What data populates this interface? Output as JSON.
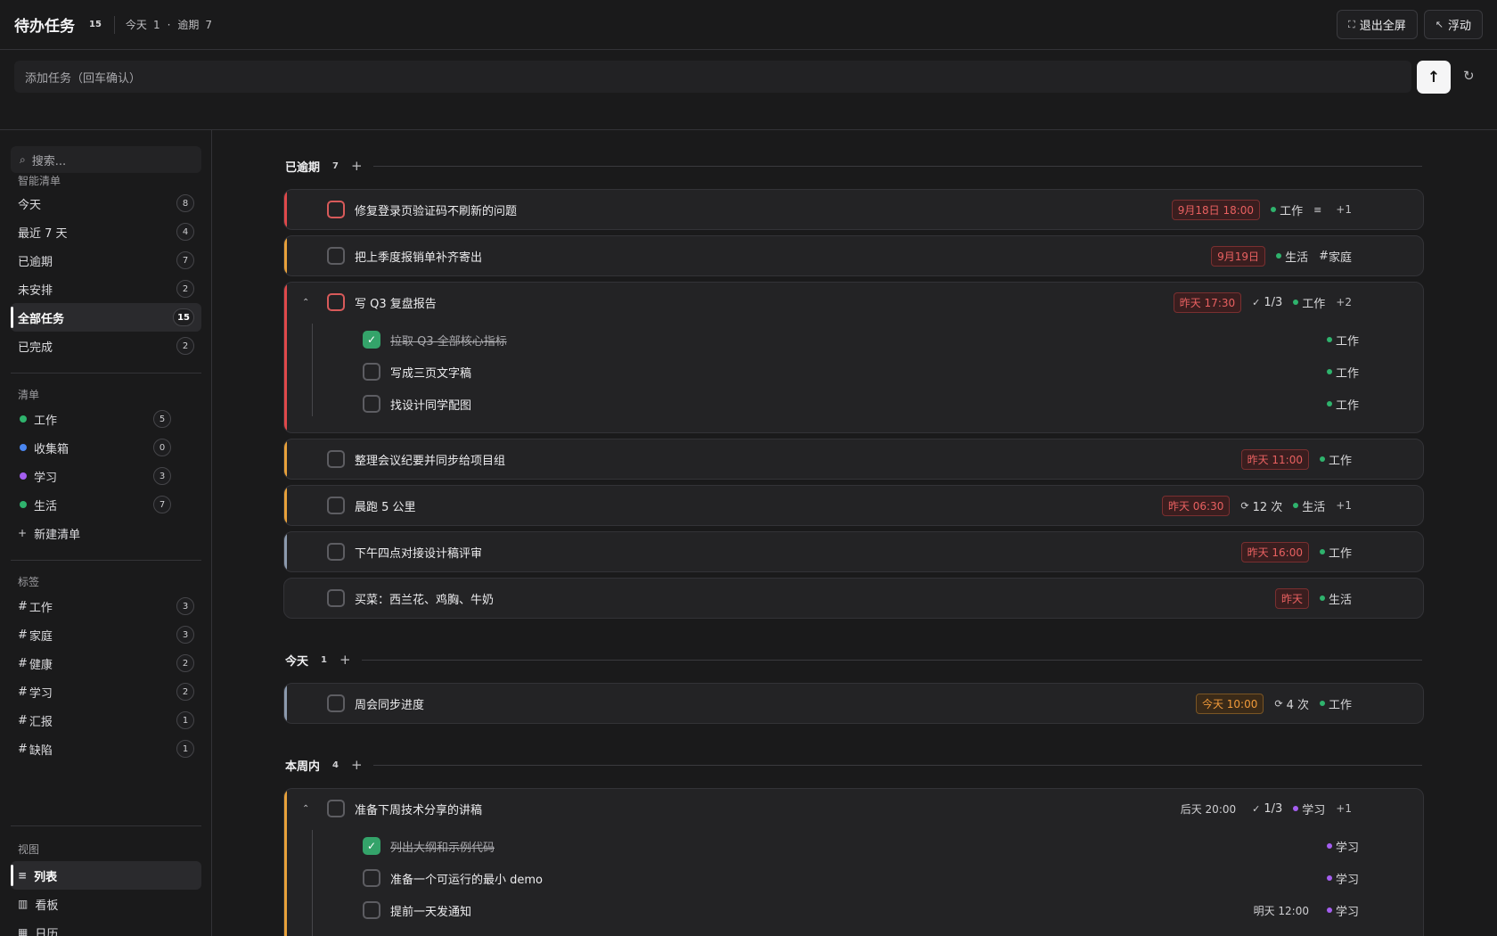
{
  "header": {
    "title": "待办任务",
    "count": "15",
    "today_label": "今天",
    "today_count": "1",
    "sep": "·",
    "overdue_label": "逾期",
    "overdue_count": "7",
    "exit_fullscreen": "退出全屏",
    "float": "浮动"
  },
  "add": {
    "placeholder": "添加任务（回车确认）"
  },
  "sidebar": {
    "search_placeholder": "搜索...",
    "smart_title": "智能清单",
    "smart": [
      {
        "label": "今天",
        "count": "8"
      },
      {
        "label": "最近 7 天",
        "count": "4"
      },
      {
        "label": "已逾期",
        "count": "7"
      },
      {
        "label": "未安排",
        "count": "2"
      },
      {
        "label": "全部任务",
        "count": "15"
      },
      {
        "label": "已完成",
        "count": "2"
      }
    ],
    "lists_title": "清单",
    "lists": [
      {
        "label": "工作",
        "count": "5",
        "color": "#2fb36d"
      },
      {
        "label": "收集箱",
        "count": "0",
        "color": "#4a86f0"
      },
      {
        "label": "学习",
        "count": "3",
        "color": "#a45ef0"
      },
      {
        "label": "生活",
        "count": "7",
        "color": "#2fb36d"
      }
    ],
    "new_list": "新建清单",
    "tags_title": "标签",
    "tags": [
      {
        "label": "工作",
        "count": "3"
      },
      {
        "label": "家庭",
        "count": "3"
      },
      {
        "label": "健康",
        "count": "2"
      },
      {
        "label": "学习",
        "count": "2"
      },
      {
        "label": "汇报",
        "count": "1"
      },
      {
        "label": "缺陷",
        "count": "1"
      }
    ],
    "views_title": "视图",
    "views": [
      {
        "label": "列表",
        "icon": "list-icon"
      },
      {
        "label": "看板",
        "icon": "kanban-icon"
      },
      {
        "label": "日历",
        "icon": "calendar-icon"
      }
    ]
  },
  "groups": [
    {
      "title": "已逾期",
      "count": "7",
      "plus": "+"
    },
    {
      "title": "今天",
      "count": "1",
      "plus": "+"
    },
    {
      "title": "本周内",
      "count": "4",
      "plus": "+"
    }
  ],
  "tasks": {
    "t1": {
      "title": "修复登录页验证码不刷新的问题",
      "date": "9月18日 18:00",
      "list": "工作",
      "extra": "+1",
      "accent": "#e0484a"
    },
    "t2": {
      "title": "把上季度报销单补齐寄出",
      "date": "9月19日",
      "list": "生活",
      "tag": "家庭",
      "accent": "#e8a13a"
    },
    "t3": {
      "title": "写 Q3 复盘报告",
      "date": "昨天 17:30",
      "progress": "1/3",
      "list": "工作",
      "extra": "+2",
      "accent": "#e0484a",
      "subs": [
        {
          "title": "拉取 Q3 全部核心指标",
          "list": "工作",
          "done": true
        },
        {
          "title": "写成三页文字稿",
          "list": "工作",
          "done": false
        },
        {
          "title": "找设计同学配图",
          "list": "工作",
          "done": false
        }
      ]
    },
    "t4": {
      "title": "整理会议纪要并同步给项目组",
      "date": "昨天 11:00",
      "list": "工作",
      "accent": "#e8a13a"
    },
    "t5": {
      "title": "晨跑 5 公里",
      "date": "昨天 06:30",
      "repeat": "12 次",
      "list": "生活",
      "extra": "+1",
      "accent": "#e8a13a"
    },
    "t6": {
      "title": "下午四点对接设计稿评审",
      "date": "昨天 16:00",
      "list": "工作",
      "accent": "#8c9aae"
    },
    "t7": {
      "title": "买菜：西兰花、鸡胸、牛奶",
      "date": "昨天",
      "list": "生活",
      "accent": "#232325"
    },
    "t8": {
      "title": "周会同步进度",
      "date": "今天 10:00",
      "repeat": "4 次",
      "list": "工作",
      "accent": "#8c9aae"
    },
    "t9": {
      "title": "准备下周技术分享的讲稿",
      "date": "后天 20:00",
      "progress": "1/3",
      "list": "学习",
      "extra": "+1",
      "accent": "#e8a13a",
      "subs": [
        {
          "title": "列出大纲和示例代码",
          "list": "学习",
          "done": true
        },
        {
          "title": "准备一个可运行的最小 demo",
          "list": "学习",
          "done": false
        },
        {
          "title": "提前一天发通知",
          "list": "学习",
          "date": "明天 12:00",
          "done": false
        }
      ]
    }
  },
  "colors": {
    "work": "#2fb36d",
    "life": "#2fb36d",
    "study": "#a45ef0",
    "overdue": "#e86060",
    "today": "#f09a3a"
  }
}
